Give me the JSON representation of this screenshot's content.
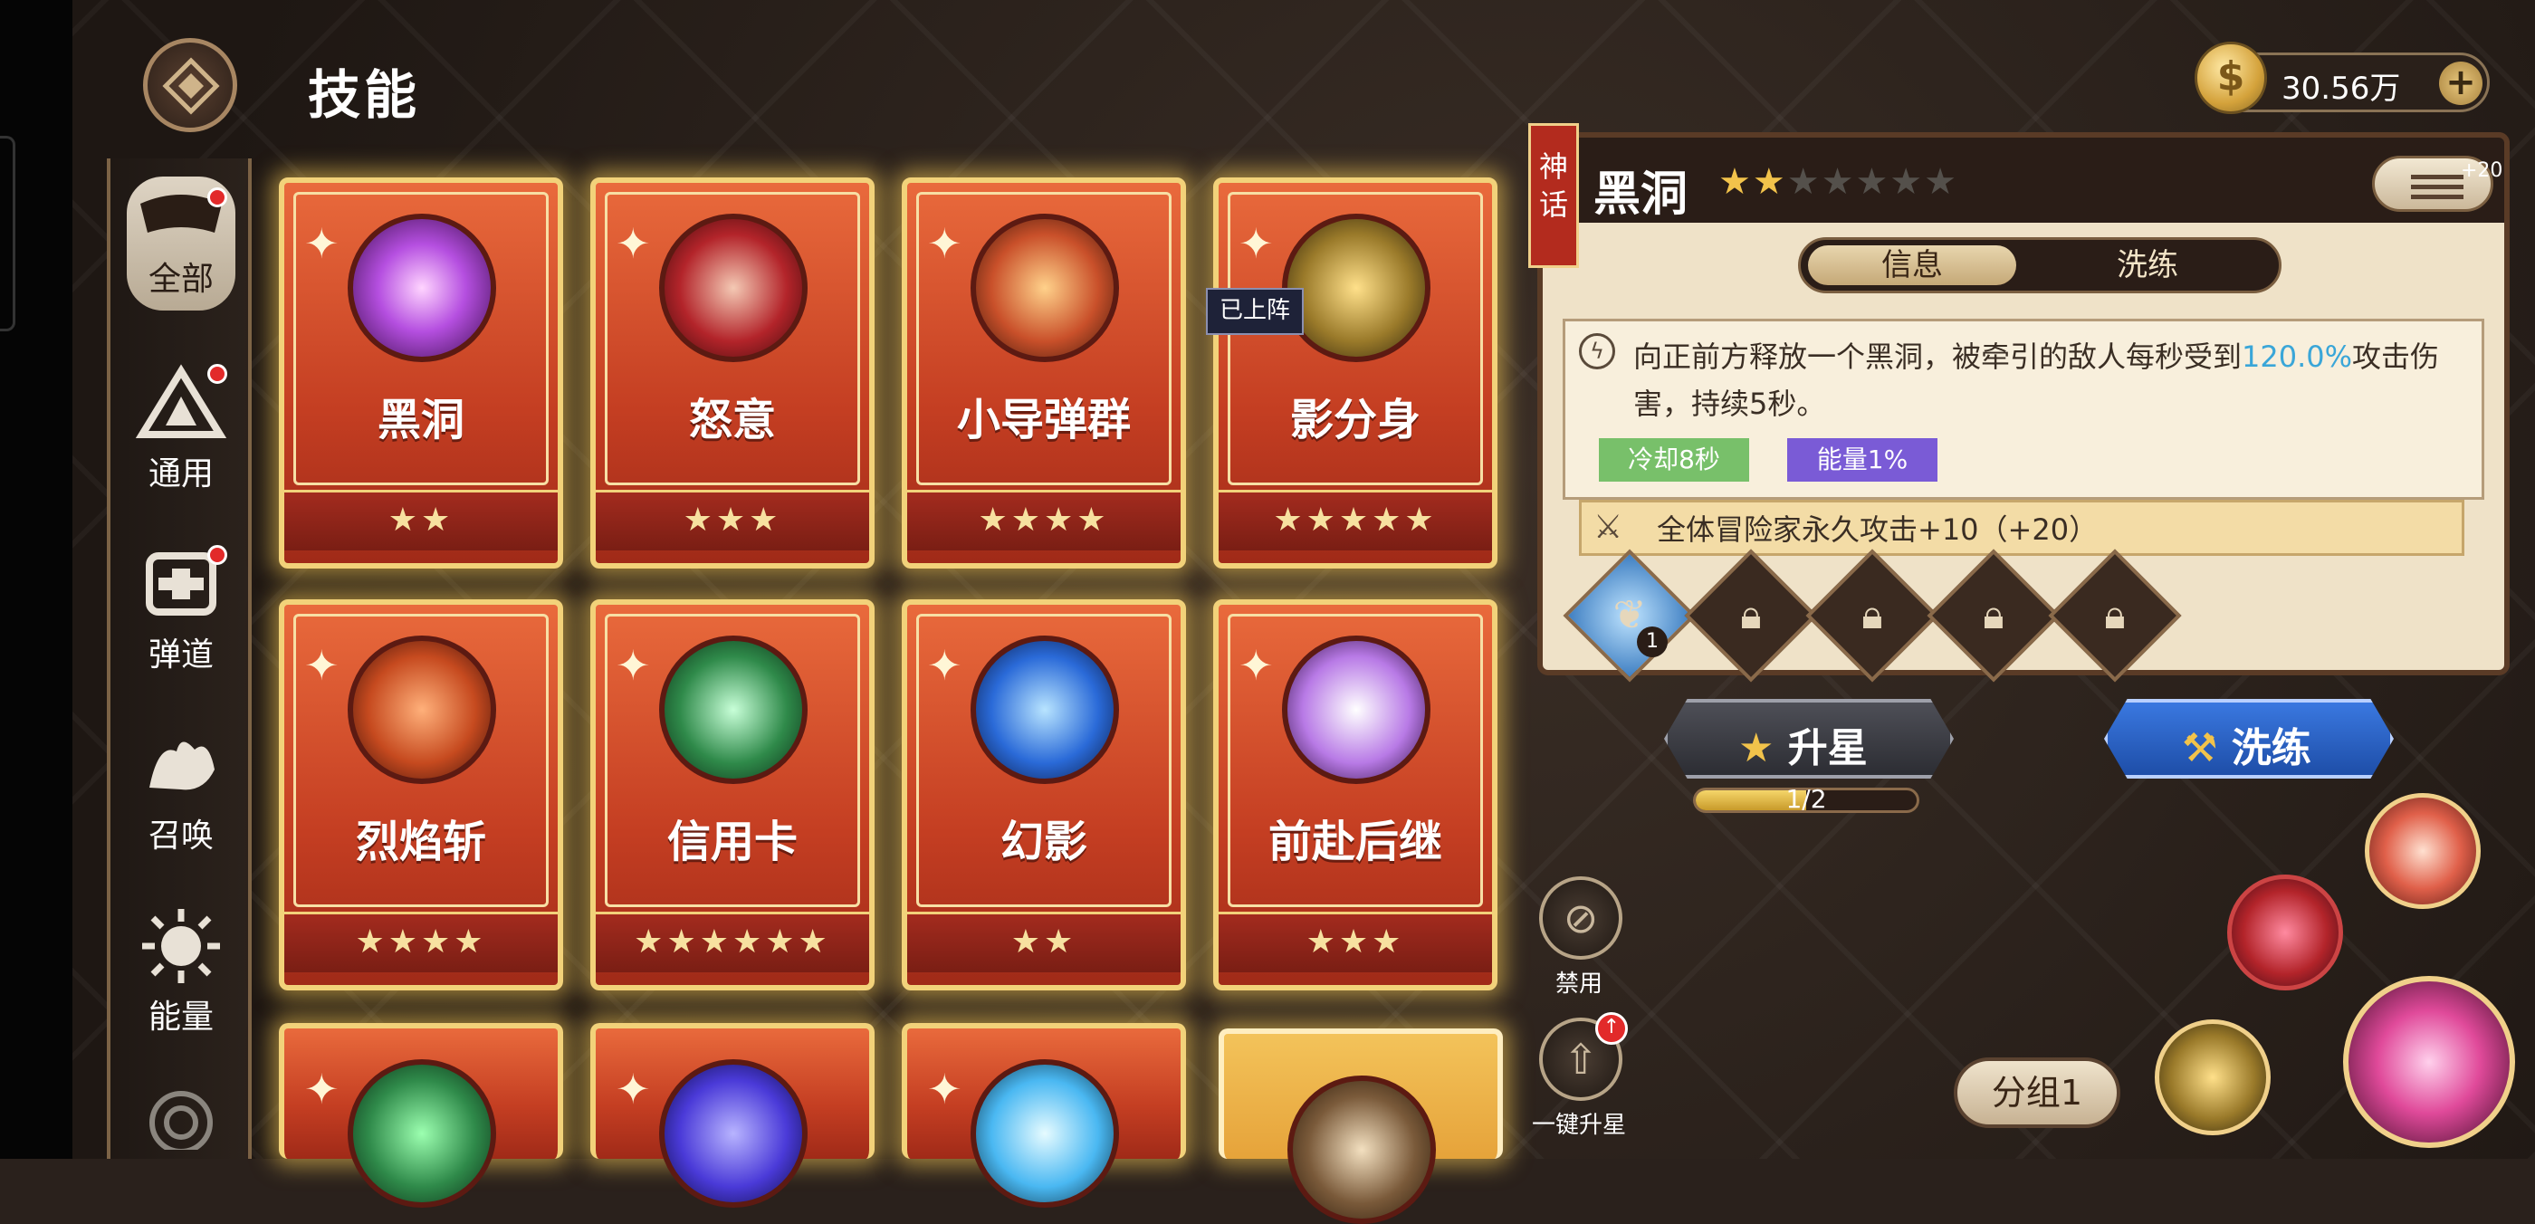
{
  "page": {
    "title": "技能"
  },
  "currency": {
    "value": "30.56万",
    "plus": "+"
  },
  "sidebar": {
    "items": [
      {
        "label": "全部",
        "dot": true
      },
      {
        "label": "通用",
        "dot": true
      },
      {
        "label": "弹道",
        "dot": true
      },
      {
        "label": "召唤",
        "dot": false
      },
      {
        "label": "能量",
        "dot": false
      }
    ]
  },
  "cards": [
    {
      "name": "黑洞",
      "stars": "★★",
      "theme": "#b54fe0"
    },
    {
      "name": "怒意",
      "stars": "★★★",
      "theme": "#b3242a"
    },
    {
      "name": "小导弹群",
      "stars": "★★★★",
      "theme": "#c9502a"
    },
    {
      "name": "影分身",
      "stars": "★★★★★",
      "theme": "#9a7a2a"
    },
    {
      "name": "烈焰斩",
      "stars": "★★★★",
      "theme": "#c64a1f"
    },
    {
      "name": "信用卡",
      "stars": "★★★★★★",
      "theme": "#2f8a4a"
    },
    {
      "name": "幻影",
      "stars": "★★",
      "theme": "#2a6ad8"
    },
    {
      "name": "前赴后继",
      "stars": "★★★",
      "theme": "#b87ae6"
    }
  ],
  "onteam_badge": "已上阵",
  "detail": {
    "rarity": "神话",
    "title": "黑洞",
    "stars_on": "★★",
    "stars_off": "★★★★★",
    "plus20": "+20",
    "tabs": [
      "信息",
      "洗练"
    ],
    "desc_main": "向正前方释放一个黑洞，被牵引的敌人每秒受到",
    "desc_highlight": "120.0%",
    "desc_tail": "攻击伤害，持续5秒。",
    "tag_cooldown": "冷却8秒",
    "tag_energy": "能量1%",
    "bonus": "全体冒险家永久攻击+10（+20）",
    "rune_count": "1"
  },
  "upgrade": {
    "label": "升星",
    "progress_text": "1/2",
    "progress": 0.5
  },
  "refine": {
    "label": "洗练"
  },
  "actions": {
    "disable": "禁用",
    "one_click_upgrade": "一键升星",
    "group": "分组1"
  }
}
